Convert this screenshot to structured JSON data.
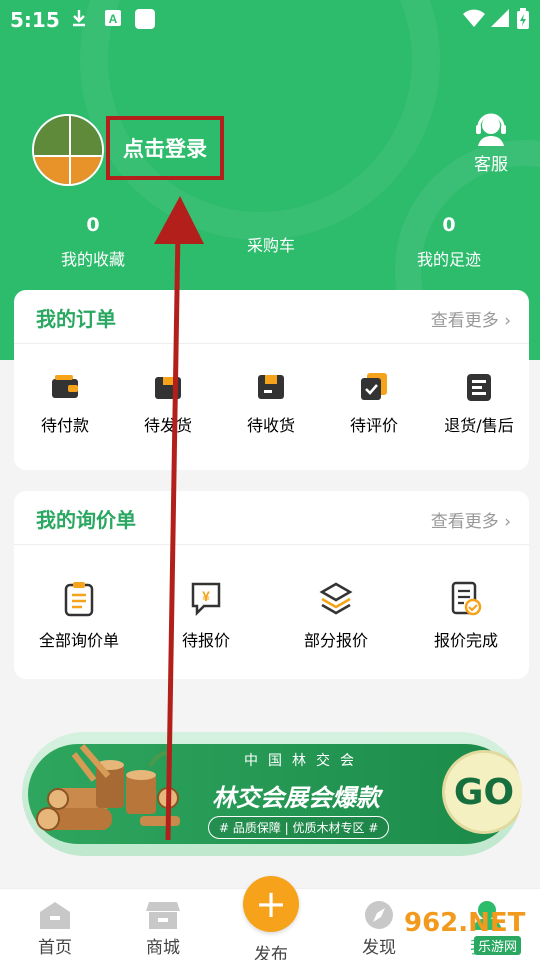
{
  "status_bar": {
    "time": "5:15"
  },
  "profile": {
    "login_text": "点击登录",
    "service_label": "客服"
  },
  "stats": [
    {
      "value": "0",
      "label": "我的收藏"
    },
    {
      "value": "",
      "label": "采购车"
    },
    {
      "value": "0",
      "label": "我的足迹"
    }
  ],
  "orders": {
    "title": "我的订单",
    "more": "查看更多",
    "items": [
      {
        "label": "待付款",
        "icon": "wallet-icon"
      },
      {
        "label": "待发货",
        "icon": "package-icon"
      },
      {
        "label": "待收货",
        "icon": "receive-box-icon"
      },
      {
        "label": "待评价",
        "icon": "review-icon"
      },
      {
        "label": "退货/售后",
        "icon": "return-icon"
      }
    ]
  },
  "inquiries": {
    "title": "我的询价单",
    "more": "查看更多",
    "items": [
      {
        "label": "全部询价单",
        "icon": "clipboard-list-icon"
      },
      {
        "label": "待报价",
        "icon": "quote-message-icon"
      },
      {
        "label": "部分报价",
        "icon": "layers-icon"
      },
      {
        "label": "报价完成",
        "icon": "document-check-icon"
      }
    ]
  },
  "banner": {
    "subtitle": "中国林交会",
    "title": "林交会展会爆款",
    "tag": "# 品质保障 | 优质木材专区 #",
    "go": "GO"
  },
  "tabbar": {
    "home": "首页",
    "mall": "商城",
    "publish": "发布",
    "discover": "发现",
    "mine": "我的"
  },
  "watermark": {
    "number": "962.NET",
    "sub": "乐游网"
  },
  "colors": {
    "primary": "#2dbb6c",
    "accent": "#f6a21a",
    "highlight_box": "#b3201b"
  }
}
